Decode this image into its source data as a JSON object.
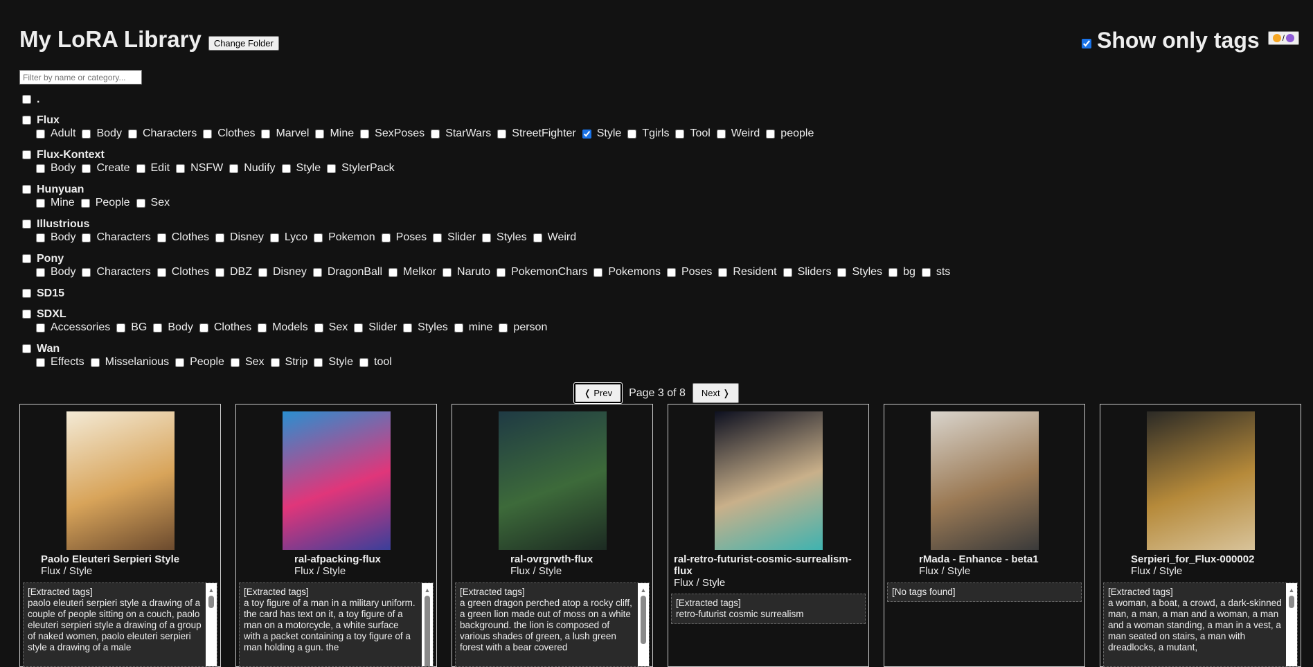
{
  "header": {
    "title": "My LoRA Library",
    "change_folder": "Change Folder",
    "show_only_tags": "Show only tags",
    "theme_toggle": "/"
  },
  "filter": {
    "placeholder": "Filter by name or category..."
  },
  "categories": [
    {
      "name": ".",
      "checked": false,
      "subs": []
    },
    {
      "name": "Flux",
      "checked": false,
      "subs": [
        {
          "n": "Adult"
        },
        {
          "n": "Body"
        },
        {
          "n": "Characters"
        },
        {
          "n": "Clothes"
        },
        {
          "n": "Marvel"
        },
        {
          "n": "Mine"
        },
        {
          "n": "SexPoses"
        },
        {
          "n": "StarWars"
        },
        {
          "n": "StreetFighter"
        },
        {
          "n": "Style",
          "c": true
        },
        {
          "n": "Tgirls"
        },
        {
          "n": "Tool"
        },
        {
          "n": "Weird"
        },
        {
          "n": "people"
        }
      ]
    },
    {
      "name": "Flux-Kontext",
      "checked": false,
      "subs": [
        {
          "n": "Body"
        },
        {
          "n": "Create"
        },
        {
          "n": "Edit"
        },
        {
          "n": "NSFW"
        },
        {
          "n": "Nudify"
        },
        {
          "n": "Style"
        },
        {
          "n": "StylerPack"
        }
      ]
    },
    {
      "name": "Hunyuan",
      "checked": false,
      "subs": [
        {
          "n": "Mine"
        },
        {
          "n": "People"
        },
        {
          "n": "Sex"
        }
      ]
    },
    {
      "name": "Illustrious",
      "checked": false,
      "subs": [
        {
          "n": "Body"
        },
        {
          "n": "Characters"
        },
        {
          "n": "Clothes"
        },
        {
          "n": "Disney"
        },
        {
          "n": "Lyco"
        },
        {
          "n": "Pokemon"
        },
        {
          "n": "Poses"
        },
        {
          "n": "Slider"
        },
        {
          "n": "Styles"
        },
        {
          "n": "Weird"
        }
      ]
    },
    {
      "name": "Pony",
      "checked": false,
      "subs": [
        {
          "n": "Body"
        },
        {
          "n": "Characters"
        },
        {
          "n": "Clothes"
        },
        {
          "n": "DBZ"
        },
        {
          "n": "Disney"
        },
        {
          "n": "DragonBall"
        },
        {
          "n": "Melkor"
        },
        {
          "n": "Naruto"
        },
        {
          "n": "PokemonChars"
        },
        {
          "n": "Pokemons"
        },
        {
          "n": "Poses"
        },
        {
          "n": "Resident"
        },
        {
          "n": "Sliders"
        },
        {
          "n": "Styles"
        },
        {
          "n": "bg"
        },
        {
          "n": "sts"
        }
      ]
    },
    {
      "name": "SD15",
      "checked": false,
      "subs": []
    },
    {
      "name": "SDXL",
      "checked": false,
      "subs": [
        {
          "n": "Accessories"
        },
        {
          "n": "BG"
        },
        {
          "n": "Body"
        },
        {
          "n": "Clothes"
        },
        {
          "n": "Models"
        },
        {
          "n": "Sex"
        },
        {
          "n": "Slider"
        },
        {
          "n": "Styles"
        },
        {
          "n": "mine"
        },
        {
          "n": "person"
        }
      ]
    },
    {
      "name": "Wan",
      "checked": false,
      "subs": [
        {
          "n": "Effects"
        },
        {
          "n": "Misselanious"
        },
        {
          "n": "People"
        },
        {
          "n": "Sex"
        },
        {
          "n": "Strip"
        },
        {
          "n": "Style"
        },
        {
          "n": "tool"
        }
      ]
    }
  ],
  "pager": {
    "prev": "❬ Prev",
    "status": "Page 3 of 8",
    "next": "Next ❭"
  },
  "cards": [
    {
      "name": "Paolo Eleuteri Serpieri Style",
      "cat": "Flux / Style",
      "tags": "[Extracted tags]\npaolo eleuteri serpieri style a drawing of a couple of people sitting on a couch, paolo eleuteri serpieri style a drawing of a group of naked women, paolo eleuteri serpieri style a drawing of a male",
      "scroll": true,
      "thumb": 40,
      "img": [
        "#f3ead6",
        "#d8a45a",
        "#6b4a2e"
      ]
    },
    {
      "name": "ral-afpacking-flux",
      "cat": "Flux / Style",
      "tags": "[Extracted tags]\na toy figure of a man in a military uniform. the card has text on it, a toy figure of a man on a motorcycle, a white surface with a packet containing a toy figure of a man holding a gun. the",
      "scroll": true,
      "thumb": 120,
      "img": [
        "#2a8fd0",
        "#e0367a",
        "#3a3f9a"
      ]
    },
    {
      "name": "ral-ovrgrwth-flux",
      "cat": "Flux / Style",
      "tags": "[Extracted tags]\na green dragon perched atop a rocky cliff, a green lion made out of moss on a white background. the lion is composed of various shades of green, a lush green forest with a bear covered",
      "scroll": true,
      "thumb": 70,
      "img": [
        "#1f3a44",
        "#3d6a3a",
        "#1c2a22"
      ]
    },
    {
      "name": "ral-retro-futurist-cosmic-surrealism-flux",
      "cat": "Flux / Style",
      "tags": "[Extracted tags]\nretro-futurist cosmic surrealism",
      "scroll": false,
      "img": [
        "#0d1020",
        "#c9b08a",
        "#3fb3b0"
      ]
    },
    {
      "name": "rMada - Enhance - beta1",
      "cat": "Flux / Style",
      "tags": "[No tags found]",
      "scroll": false,
      "img": [
        "#d9d4cc",
        "#9b7a55",
        "#3a3a3a"
      ]
    },
    {
      "name": "Serpieri_for_Flux-000002",
      "cat": "Flux / Style",
      "tags": "[Extracted tags]\na  woman, a boat, a crowd, a dark-skinned man, a man, a man and a woman, a man and a woman standing, a man in a vest, a man seated on stairs, a man with dreadlocks, a mutant,",
      "scroll": true,
      "thumb": 40,
      "img": [
        "#2b2a26",
        "#b68a3a",
        "#d8c39a"
      ]
    }
  ]
}
